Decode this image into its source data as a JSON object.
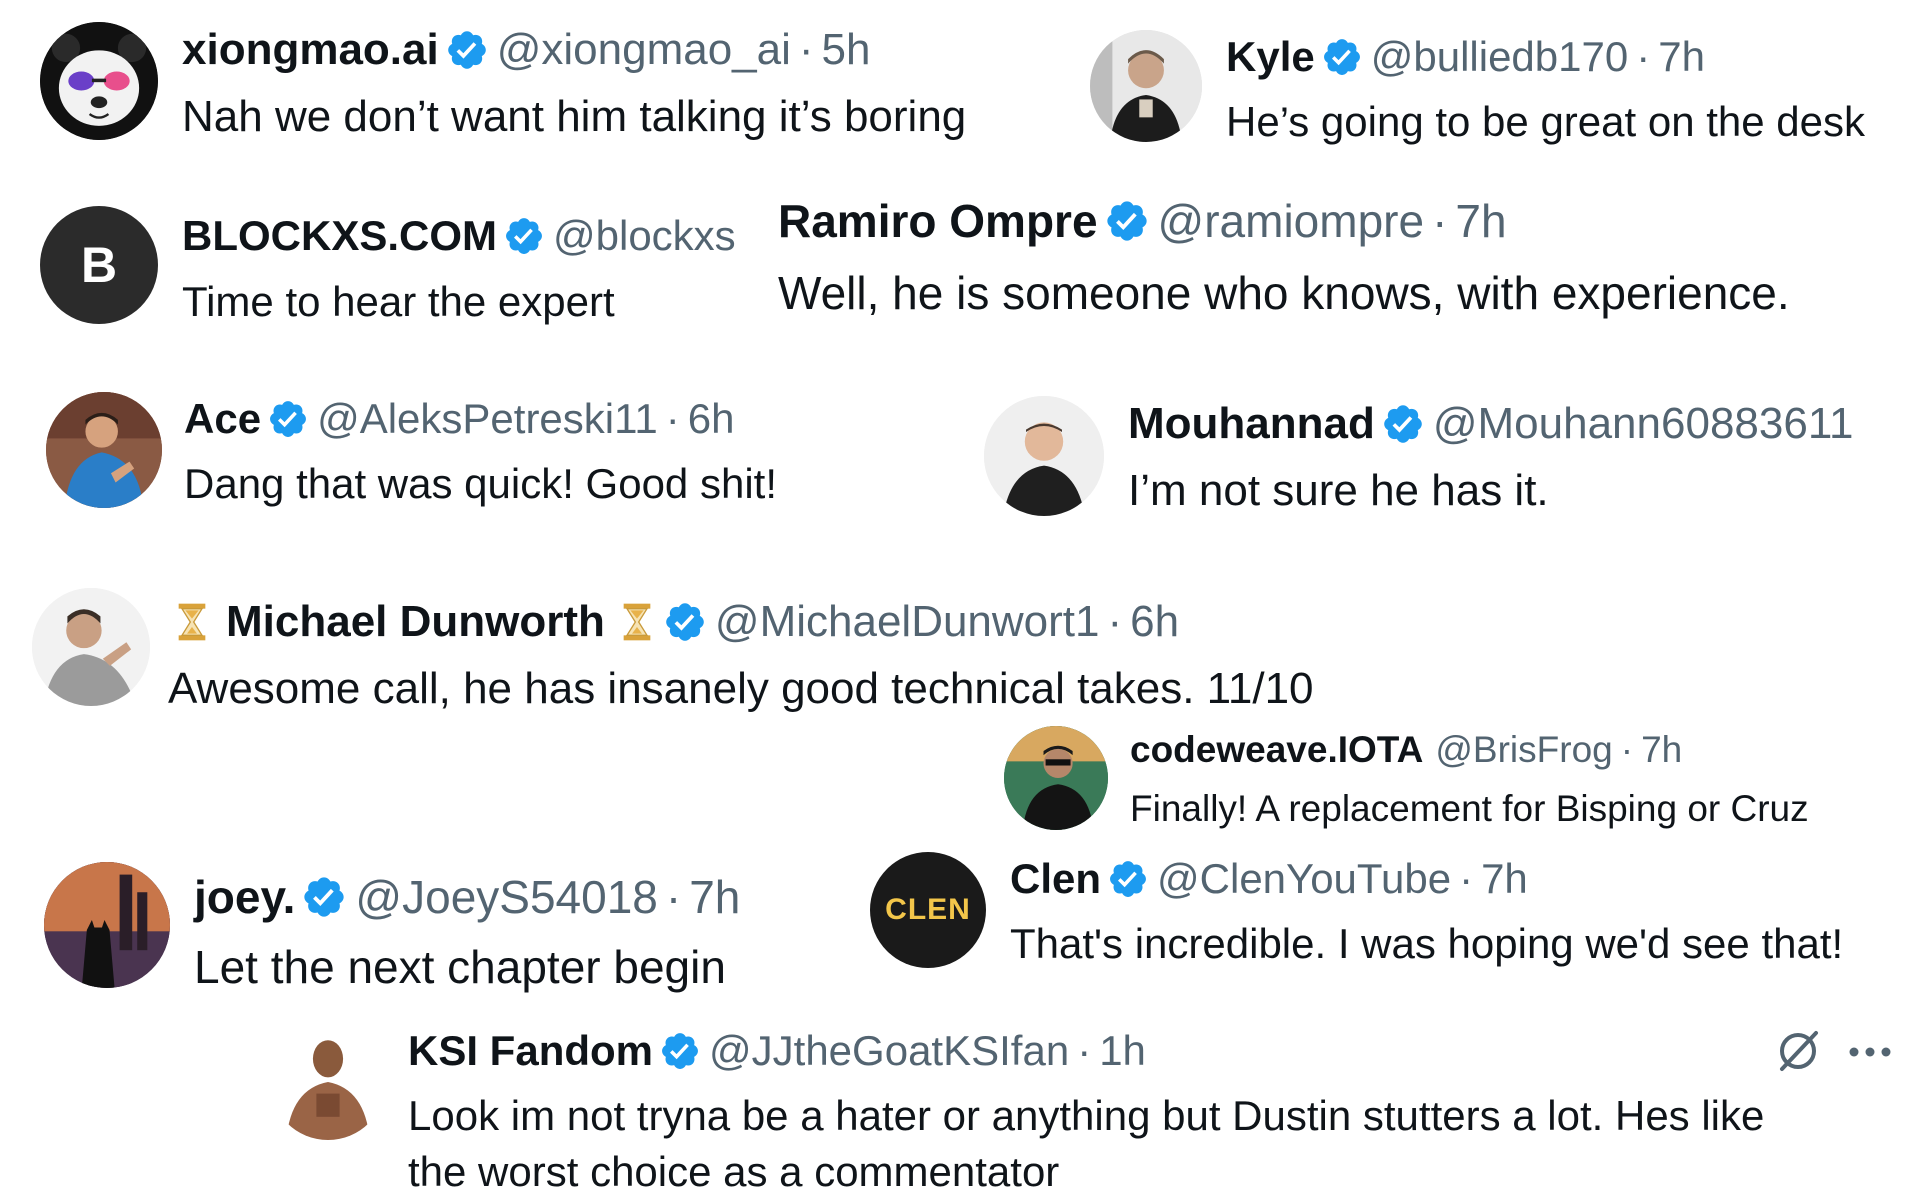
{
  "colors": {
    "verified_blue": "#1d9bf0",
    "handle_gray": "#536471",
    "text_black": "#0f1419"
  },
  "icons": {
    "verified": "verified-badge-icon",
    "hourglass": "hourglass-icon",
    "grok": "grok-slash-icon",
    "more": "more-dots-icon"
  },
  "replies": [
    {
      "name": "xiongmao.ai",
      "handle": "@xiongmao_ai",
      "sep": "·",
      "time": "5h",
      "text": "Nah we don’t want him talking it’s boring",
      "avatar": "panda"
    },
    {
      "name": "Kyle",
      "handle": "@bulliedb170",
      "sep": "·",
      "time": "7h",
      "text": "He’s going to be great on the desk",
      "avatar": "person-dark"
    },
    {
      "name": "BLOCKXS.COM",
      "handle": "@blockxs",
      "sep": "",
      "time": "",
      "text": "Time to hear the expert",
      "avatar": "blockxs-logo",
      "avatar_letter": "B"
    },
    {
      "name": "Ramiro Ompre",
      "handle": "@ramiompre",
      "sep": "·",
      "time": "7h",
      "text": "Well, he is someone who knows, with experience.",
      "avatar": "none"
    },
    {
      "name": "Ace",
      "handle": "@AleksPetreski11",
      "sep": "·",
      "time": "6h",
      "text": "Dang that was quick! Good shit!",
      "avatar": "person-blue"
    },
    {
      "name": "Mouhannad",
      "handle": "@Mouhann60883611",
      "sep": "",
      "time": "",
      "text": "I’m not sure he has it.",
      "avatar": "person-light"
    },
    {
      "name": "Michael Dunworth",
      "handle": "@MichaelDunwort1",
      "sep": "·",
      "time": "6h",
      "text": "Awesome call, he has insanely good technical takes. 11/10",
      "avatar": "person-gray"
    },
    {
      "name": "codeweave.IOTA",
      "handle": "@BrisFrog",
      "sep": "·",
      "time": "7h",
      "text": "Finally! A replacement for Bisping or Cruz",
      "avatar": "person-sunglasses"
    },
    {
      "name": "joey.",
      "handle": "@JoeyS54018",
      "sep": "·",
      "time": "7h",
      "text": "Let the next chapter begin",
      "avatar": "batman"
    },
    {
      "name": "Clen",
      "handle": "@ClenYouTube",
      "sep": "·",
      "time": "7h",
      "text": "That's incredible. I was hoping we'd see that!",
      "avatar": "clen-logo",
      "avatar_label": "CLEN"
    },
    {
      "name": "KSI Fandom",
      "handle": "@JJtheGoatKSIfan",
      "sep": "·",
      "time": "1h",
      "text": "Look im not tryna be a hater or anything but Dustin stutters a lot. Hes like",
      "text2": "the worst choice as a commentator",
      "avatar": "fighter"
    }
  ]
}
